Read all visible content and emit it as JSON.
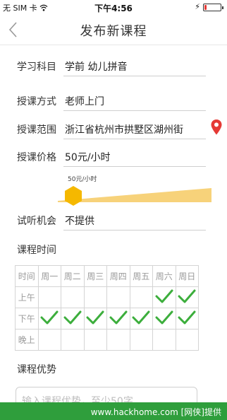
{
  "status_bar": {
    "carrier": "无 SIM 卡",
    "time": "下午4:56",
    "battery_level": 0.15,
    "battery_color": "#e53935"
  },
  "nav": {
    "title": "发布新课程",
    "back_icon": "chevron-left-icon"
  },
  "form": {
    "subject": {
      "label": "学习科目",
      "value": "学前  幼儿拼音"
    },
    "mode": {
      "label": "授课方式",
      "value": "老师上门"
    },
    "area": {
      "label": "授课范围",
      "value": "浙江省杭州市拱墅区湖州街"
    },
    "price": {
      "label": "授课价格",
      "value": "50元/小时"
    },
    "trial": {
      "label": "试听机会",
      "value": "不提供"
    }
  },
  "slider": {
    "label": "50元/小时",
    "level": 0.1,
    "track_color": "#f7d27a",
    "thumb_color": "#f5b800"
  },
  "schedule": {
    "title": "课程时间",
    "header": [
      "时间",
      "周一",
      "周二",
      "周三",
      "周四",
      "周五",
      "周六",
      "周日"
    ],
    "rows": [
      {
        "label": "上午",
        "checked": [
          false,
          false,
          false,
          false,
          false,
          true,
          true
        ]
      },
      {
        "label": "下午",
        "checked": [
          true,
          true,
          true,
          true,
          true,
          true,
          true
        ]
      },
      {
        "label": "晚上",
        "checked": [
          false,
          false,
          false,
          false,
          false,
          false,
          false
        ]
      }
    ],
    "check_color": "#3cae3c"
  },
  "advantage": {
    "title": "课程优势",
    "placeholder": "输入课程优势，至少50字..."
  },
  "watermark": {
    "text": "www.hackhome.com [网侠]提供"
  }
}
